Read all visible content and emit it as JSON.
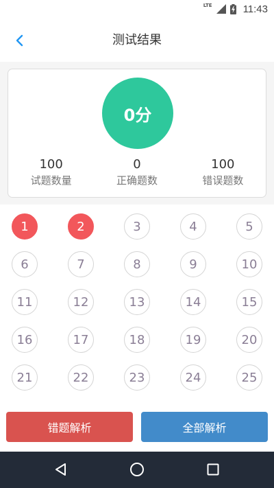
{
  "status_bar": {
    "network": "LTE",
    "time": "11:43"
  },
  "toolbar": {
    "title": "测试结果"
  },
  "summary": {
    "score": "0分",
    "stats": [
      {
        "value": "100",
        "label": "试题数量"
      },
      {
        "value": "0",
        "label": "正确题数"
      },
      {
        "value": "100",
        "label": "错误题数"
      }
    ]
  },
  "questions": [
    {
      "number": "1",
      "status": "wrong"
    },
    {
      "number": "2",
      "status": "wrong"
    },
    {
      "number": "3",
      "status": "unanswered"
    },
    {
      "number": "4",
      "status": "unanswered"
    },
    {
      "number": "5",
      "status": "unanswered"
    },
    {
      "number": "6",
      "status": "unanswered"
    },
    {
      "number": "7",
      "status": "unanswered"
    },
    {
      "number": "8",
      "status": "unanswered"
    },
    {
      "number": "9",
      "status": "unanswered"
    },
    {
      "number": "10",
      "status": "unanswered"
    },
    {
      "number": "11",
      "status": "unanswered"
    },
    {
      "number": "12",
      "status": "unanswered"
    },
    {
      "number": "13",
      "status": "unanswered"
    },
    {
      "number": "14",
      "status": "unanswered"
    },
    {
      "number": "15",
      "status": "unanswered"
    },
    {
      "number": "16",
      "status": "unanswered"
    },
    {
      "number": "17",
      "status": "unanswered"
    },
    {
      "number": "18",
      "status": "unanswered"
    },
    {
      "number": "19",
      "status": "unanswered"
    },
    {
      "number": "20",
      "status": "unanswered"
    },
    {
      "number": "21",
      "status": "unanswered"
    },
    {
      "number": "22",
      "status": "unanswered"
    },
    {
      "number": "23",
      "status": "unanswered"
    },
    {
      "number": "24",
      "status": "unanswered"
    },
    {
      "number": "25",
      "status": "unanswered"
    }
  ],
  "actions": {
    "wrong_analysis": "错题解析",
    "all_analysis": "全部解析"
  },
  "colors": {
    "accent": "#2196f3",
    "score": "#2ec89c",
    "wrong": "#f2575b",
    "wrong_button": "#d9534f",
    "all_button": "#428bca",
    "nav_bar": "#232b38"
  },
  "icons": {
    "back": "chevron-left-icon",
    "nav_back": "triangle-back-icon",
    "nav_home": "circle-home-icon",
    "nav_recents": "square-recents-icon"
  }
}
